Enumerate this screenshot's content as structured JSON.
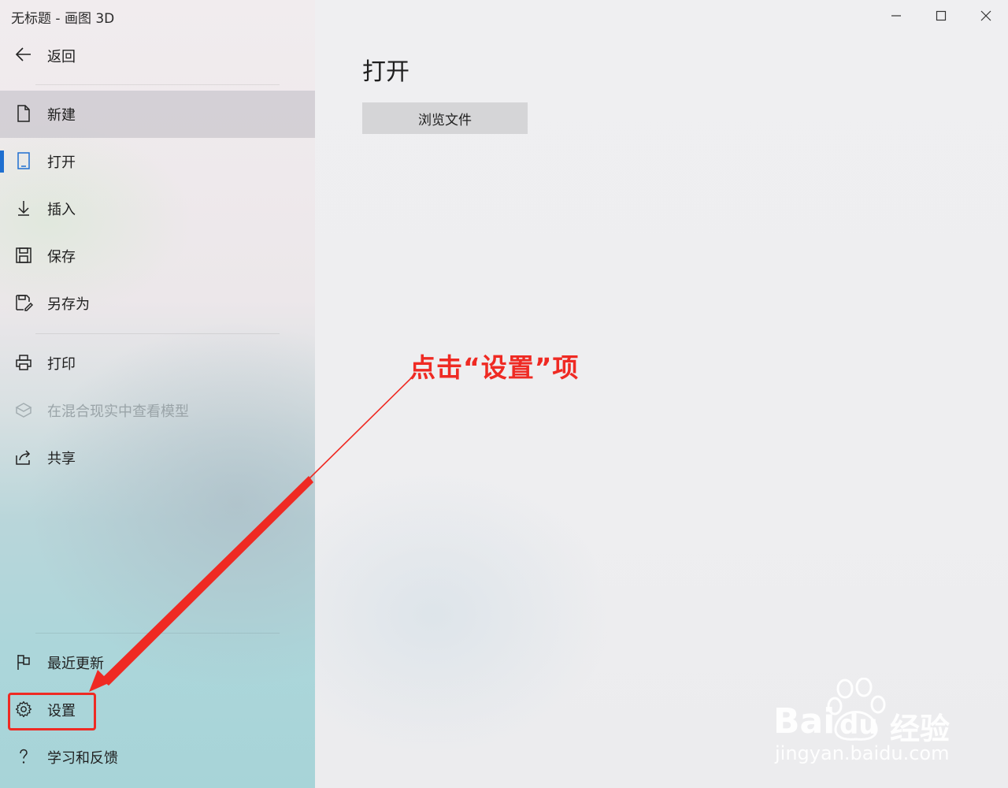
{
  "window": {
    "title": "无标题 - 画图 3D"
  },
  "sidebar": {
    "back_label": "返回",
    "items": [
      {
        "label": "新建",
        "icon": "new-file-icon",
        "state": "hover"
      },
      {
        "label": "打开",
        "icon": "open-file-icon",
        "state": "active"
      },
      {
        "label": "插入",
        "icon": "insert-arrow-icon",
        "state": "normal"
      },
      {
        "label": "保存",
        "icon": "save-icon",
        "state": "normal"
      },
      {
        "label": "另存为",
        "icon": "save-as-icon",
        "state": "normal"
      },
      {
        "label": "打印",
        "icon": "print-icon",
        "state": "normal"
      },
      {
        "label": "在混合现实中查看模型",
        "icon": "mixed-reality-icon",
        "state": "disabled"
      },
      {
        "label": "共享",
        "icon": "share-icon",
        "state": "normal"
      },
      {
        "label": "最近更新",
        "icon": "flag-icon",
        "state": "normal"
      },
      {
        "label": "设置",
        "icon": "gear-icon",
        "state": "normal"
      },
      {
        "label": "学习和反馈",
        "icon": "help-icon",
        "state": "normal"
      }
    ]
  },
  "main": {
    "title": "打开",
    "browse_button": "浏览文件"
  },
  "annotation": {
    "text": "点击“设置”项",
    "color": "#ef2a23"
  },
  "watermark": {
    "brand_latin_1": "Bai",
    "brand_latin_2": "du",
    "brand_cn": "经验",
    "url": "jingyan.baidu.com"
  },
  "colors": {
    "accent": "#1f6fd0",
    "annotation": "#ef2a23"
  }
}
